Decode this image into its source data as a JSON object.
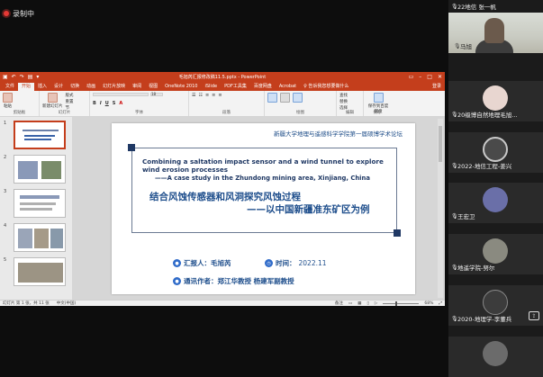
{
  "recording": {
    "label": "录制中"
  },
  "ppt": {
    "window_title": "毛旭芮汇报修改稿11.5.pptx - PowerPoint",
    "tabs": [
      "文件",
      "开始",
      "插入",
      "设计",
      "切换",
      "动画",
      "幻灯片放映",
      "审阅",
      "视图",
      "OneNote 2010",
      "iSlide",
      "PDF工具集",
      "百度网盘",
      "Acrobat",
      "♀ 告诉我您想要做什么",
      "登录"
    ],
    "active_tab_index": 1,
    "ribbon_groups": [
      "剪贴板",
      "幻灯片",
      "字体",
      "段落",
      "绘图",
      "编辑",
      "保存"
    ],
    "ribbon_buttons": {
      "paste": "粘贴",
      "new_slide": "新建幻灯片",
      "layout": "版式",
      "reset": "重置",
      "section": "节",
      "find": "查找",
      "replace": "替换",
      "select": "选择",
      "baidu_save": "保存到百度网盘",
      "font_size": "18"
    },
    "slide_numbers": [
      "1",
      "2",
      "3",
      "4",
      "5"
    ],
    "status": {
      "slide_info": "幻灯片 第 1 张，共 11 张",
      "language": "中文(中国)",
      "notes": "备注",
      "zoom": "68%"
    }
  },
  "slide": {
    "header": "新疆大学地理与遥感科学学院第一届硕博学术论坛",
    "title_en": "Combining a saltation impact sensor and a wind tunnel to explore wind erosion processes",
    "subtitle_en": "——A case study in the Zhundong mining area, Xinjiang, China",
    "title_cn_1": "结合风蚀传感器和风洞探究风蚀过程",
    "title_cn_2": "——以中国新疆准东矿区为例",
    "reporter": "汇报人：毛旭芮",
    "time_label": "时间：",
    "time_value": "2022.11",
    "authors": "通讯作者：郑江华教授    杨建军副教授"
  },
  "participants": {
    "top_label": "22地信 张一帆",
    "list": [
      {
        "name": "马旭",
        "type": "video"
      },
      {
        "name": "20级博自然地理毛旭...",
        "type": "avatar"
      },
      {
        "name": "2022-地信工程-姜兴",
        "type": "avatar"
      },
      {
        "name": "王宏卫",
        "type": "avatar"
      },
      {
        "name": "地遥学院-努尔",
        "type": "avatar"
      },
      {
        "name": "2020-地理学-李董兵",
        "type": "avatar"
      },
      {
        "name": "",
        "type": "avatar"
      }
    ]
  },
  "colors": {
    "accent": "#c43e1c",
    "slide_text": "#1e4e8c",
    "rec": "#e53935"
  }
}
